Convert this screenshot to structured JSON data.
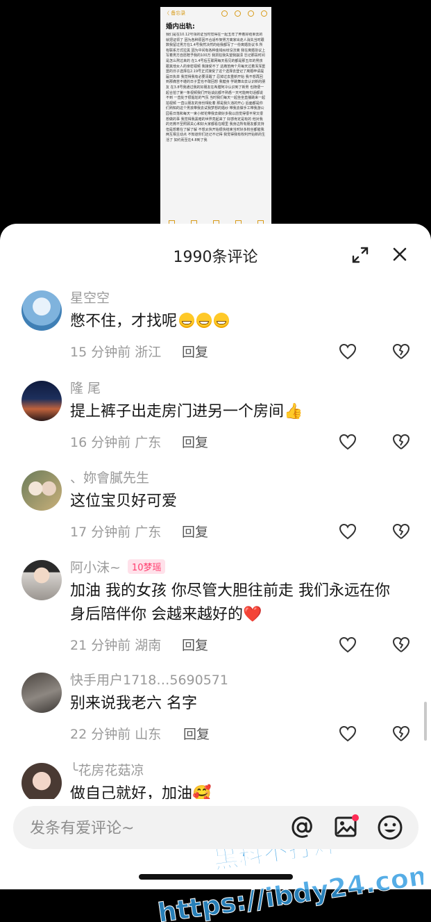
{
  "note": {
    "back": "〈 备忘录",
    "title": "婚内出轨:",
    "body": "我们是在10.12号领的证当时觉得在一起五年了奔着好结果去的就把证领了 因为各种原因不合适吵架男方离家出走人消失当时跟数我留过男方在1.4号我然决然的给我都写了一份离婚协议书 所有联系方式拉黑 因为中间有各种金钱纠纷没法离 我在离婚协议上写着男方自愿赔予我的100万 我抓狂我失望我崩溃 忘记那段时间是怎么熬过来的 在1.4号后互联网每天看见的都是那五年的男孩跟其他女人的亲密视频 我接受不了 这痛苦两个月每天过着浑浑噩噩的日子选择在2.19号正式接受了这个选择去登记了离婚申请提届日执单 我觉得我有必要清醒了 忍掉过去重新开始 我不想再回到那痛苦不堪的日子里也不敢回想 我健身 学跳舞出去认识新的朋友 在3.8号我通过我的好朋友在希腊阿冷认识到了新男 也随便一起合拍了第一条视频我们开始谈此都不熟悉一天可能两句话都说不到 一直处于很尴尬的气氛 当时我们每天一起坐坐直播跳来一起拍视频 一直以朋友的身份相处着 那是我久违的开心 后面都是你们熟知的这个男孩带我去试我梦想的婚纱 带我去做手工带我游公园看日落和每天一束小鲜花带我去做好多我以前觉得很平常又很想做的事 我觉得我黑暗的世界亮起来了 好感肯定是有的 他对我的无微不至照顾关心和好大家都看在眼里 我身边所有朋友都支持 但是想着在了解了解 不想太快开始很快结束当时好多粉丝都催我两互相主动点 不知道你们还记不记得 我觉得我有权利开始新的生活了 如约而至在4.8到了我"
  },
  "header": {
    "title": "1990条评论"
  },
  "comments": [
    {
      "user": "星空空",
      "badge": "",
      "text": "憋不住，才找呢",
      "emojis": 3,
      "time": "15 分钟前",
      "location": "浙江",
      "reply": "回复"
    },
    {
      "user": "隆 尾",
      "badge": "",
      "text": "提上裤子出走房门进另一个房间👍",
      "emojis": 0,
      "time": "16 分钟前",
      "location": "广东",
      "reply": "回复"
    },
    {
      "user": "、妳會膩先生",
      "badge": "",
      "text": "这位宝贝好可爱",
      "emojis": 0,
      "time": "17 分钟前",
      "location": "广东",
      "reply": "回复"
    },
    {
      "user": "阿小沫~",
      "badge": "10梦瑶",
      "text": "加油 我的女孩 你尽管大胆往前走 我们永远在你身后陪伴你 会越来越好的❤️",
      "emojis": 0,
      "time": "21 分钟前",
      "location": "湖南",
      "reply": "回复"
    },
    {
      "user": "快手用户1718…5690571",
      "badge": "",
      "text": "别来说我老六 名字",
      "emojis": 0,
      "time": "22 分钟前",
      "location": "山东",
      "reply": "回复"
    },
    {
      "user": "╰花房花菇凉",
      "badge": "",
      "text": "做自己就好，加油🥰",
      "emojis": 0,
      "time": "",
      "location": "",
      "reply": ""
    }
  ],
  "input": {
    "placeholder": "发条有爱评论~"
  },
  "watermark": {
    "line1": "黑料不打烊",
    "line2": "https://ibdy24.com"
  },
  "colors": {
    "accent_badge": "#ff3d6e",
    "watermark": "#2f9be0"
  }
}
